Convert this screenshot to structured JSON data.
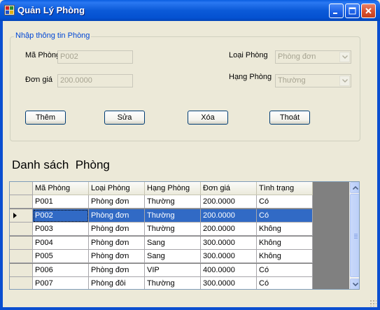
{
  "window": {
    "title": "Quản Lý Phòng"
  },
  "group": {
    "title": "Nhập thông tin Phòng",
    "ma_phong_label": "Mã Phòng",
    "ma_phong_value": "P002",
    "don_gia_label": "Đơn giá",
    "don_gia_value": "200.0000",
    "loai_phong_label": "Loại Phòng",
    "loai_phong_value": "Phòng đơn",
    "hang_phong_label": "Hạng Phòng",
    "hang_phong_value": "Thường"
  },
  "buttons": {
    "them": "Thêm",
    "sua": "Sửa",
    "xoa": "Xóa",
    "thoat": "Thoát"
  },
  "list_heading": "Danh sách  Phòng",
  "grid": {
    "columns": [
      "Mã Phòng",
      "Loại Phòng",
      "Hạng Phòng",
      "Đơn giá",
      "Tình trạng"
    ],
    "rows": [
      [
        "P001",
        "Phòng đơn",
        "Thường",
        "200.0000",
        "Có"
      ],
      [
        "P002",
        "Phòng đơn",
        "Thường",
        "200.0000",
        "Có"
      ],
      [
        "P003",
        "Phòng đơn",
        "Thường",
        "200.0000",
        "Không"
      ],
      [
        "P004",
        "Phòng đơn",
        "Sang",
        "300.0000",
        "Không"
      ],
      [
        "P005",
        "Phòng đơn",
        "Sang",
        "300.0000",
        "Không"
      ],
      [
        "P006",
        "Phòng đơn",
        "VIP",
        "400.0000",
        "Có"
      ],
      [
        "P007",
        "Phòng đôi",
        "Thường",
        "300.0000",
        "Có"
      ]
    ],
    "selected_row": 1
  }
}
